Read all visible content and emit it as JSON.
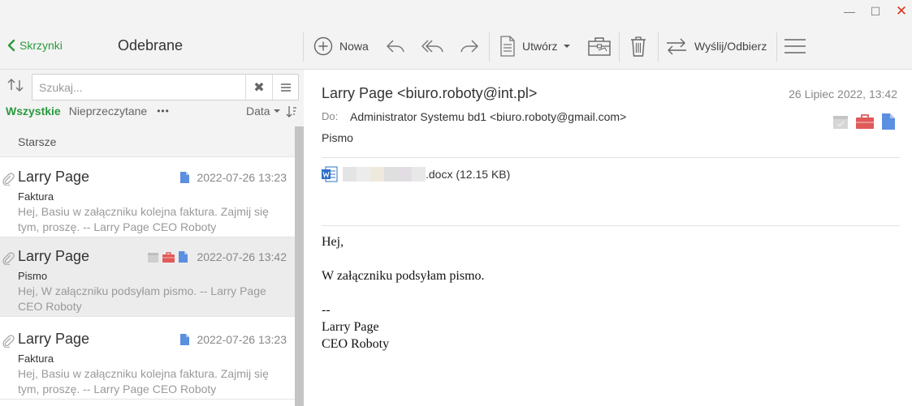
{
  "window": {
    "minimize": "—",
    "maximize": "☐",
    "close": "✕"
  },
  "toolbar": {
    "back_label": "Skrzynki",
    "folder_title": "Odebrane",
    "new_label": "Nowa",
    "create_label": "Utwórz",
    "send_receive_label": "Wyślij/Odbierz"
  },
  "search": {
    "placeholder": "Szukaj...",
    "clear": "✖"
  },
  "filters": {
    "all": "Wszystkie",
    "unread": "Nieprzeczytane",
    "more": "•••",
    "sort_by": "Data"
  },
  "list": {
    "group_label": "Starsze",
    "messages": [
      {
        "sender": "Larry Page",
        "date": "2022-07-26 13:23",
        "subject": "Faktura",
        "preview": "Hej, Basiu w załączniku kolejna faktura. Zajmij się tym, proszę. -- Larry Page CEO Roboty"
      },
      {
        "sender": "Larry Page",
        "date": "2022-07-26 13:42",
        "subject": "Pismo",
        "preview": "Hej, W załączniku podsyłam pismo. -- Larry Page CEO Roboty"
      },
      {
        "sender": "Larry Page",
        "date": "2022-07-26 13:23",
        "subject": "Faktura",
        "preview": "Hej, Basiu w załączniku kolejna faktura. Zajmij się tym, proszę. -- Larry Page CEO Roboty"
      }
    ]
  },
  "reader": {
    "from": "Larry Page <biuro.roboty@int.pl>",
    "date": "26 Lipiec 2022, 13:42",
    "to_label": "Do:",
    "to": "Administrator Systemu bd1 <biuro.roboty@gmail.com>",
    "subject": "Pismo",
    "attachment_name_suffix": ".docx (12.15 KB)",
    "body": {
      "line1": "Hej,",
      "line2": "W załączniku podsyłam pismo.",
      "line3": "--",
      "line4": "Larry Page",
      "line5": "CEO Roboty"
    }
  },
  "colors": {
    "accent_green": "#2b9a3e",
    "doc_blue": "#5b8fe0",
    "briefcase_red": "#e05a5a",
    "calendar_grey": "#cfcfcf"
  }
}
